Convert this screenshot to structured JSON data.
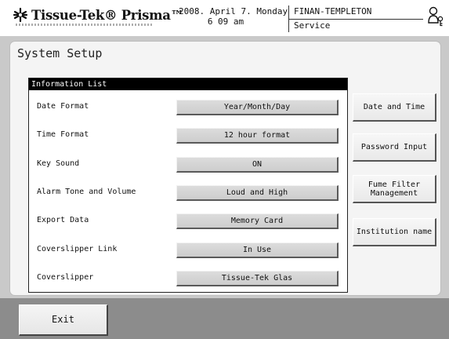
{
  "header": {
    "logo_text": "Tissue-Tek® Prisma™",
    "date_line": "2008. April 7. Monday",
    "time_line": "6 09 am",
    "user_name": "FINAN-TEMPLETON",
    "user_role": "Service",
    "user_icon": "user-key-icon"
  },
  "panel": {
    "title": "System Setup"
  },
  "info_list": {
    "header": "Information List",
    "rows": [
      {
        "label": "Date Format",
        "value": "Year/Month/Day"
      },
      {
        "label": "Time Format",
        "value": "12 hour format"
      },
      {
        "label": "Key Sound",
        "value": "ON"
      },
      {
        "label": "Alarm Tone and Volume",
        "value": "Loud and High"
      },
      {
        "label": "Export Data",
        "value": "Memory Card"
      },
      {
        "label": "Coverslipper Link",
        "value": "In Use"
      },
      {
        "label": "Coverslipper",
        "value": "Tissue-Tek Glas"
      }
    ]
  },
  "side_buttons": {
    "date_time": "Date and Time",
    "password": "Password Input",
    "fume_filter_1": "Fume Filter",
    "fume_filter_2": "Management",
    "institution": "Institution name"
  },
  "footer": {
    "exit_label": "Exit"
  },
  "colors": {
    "frame": "#c9c9c9",
    "bottom_bar": "#8c8c8c",
    "info_header_bg": "#000000",
    "button_face": "#d4d4d4"
  }
}
